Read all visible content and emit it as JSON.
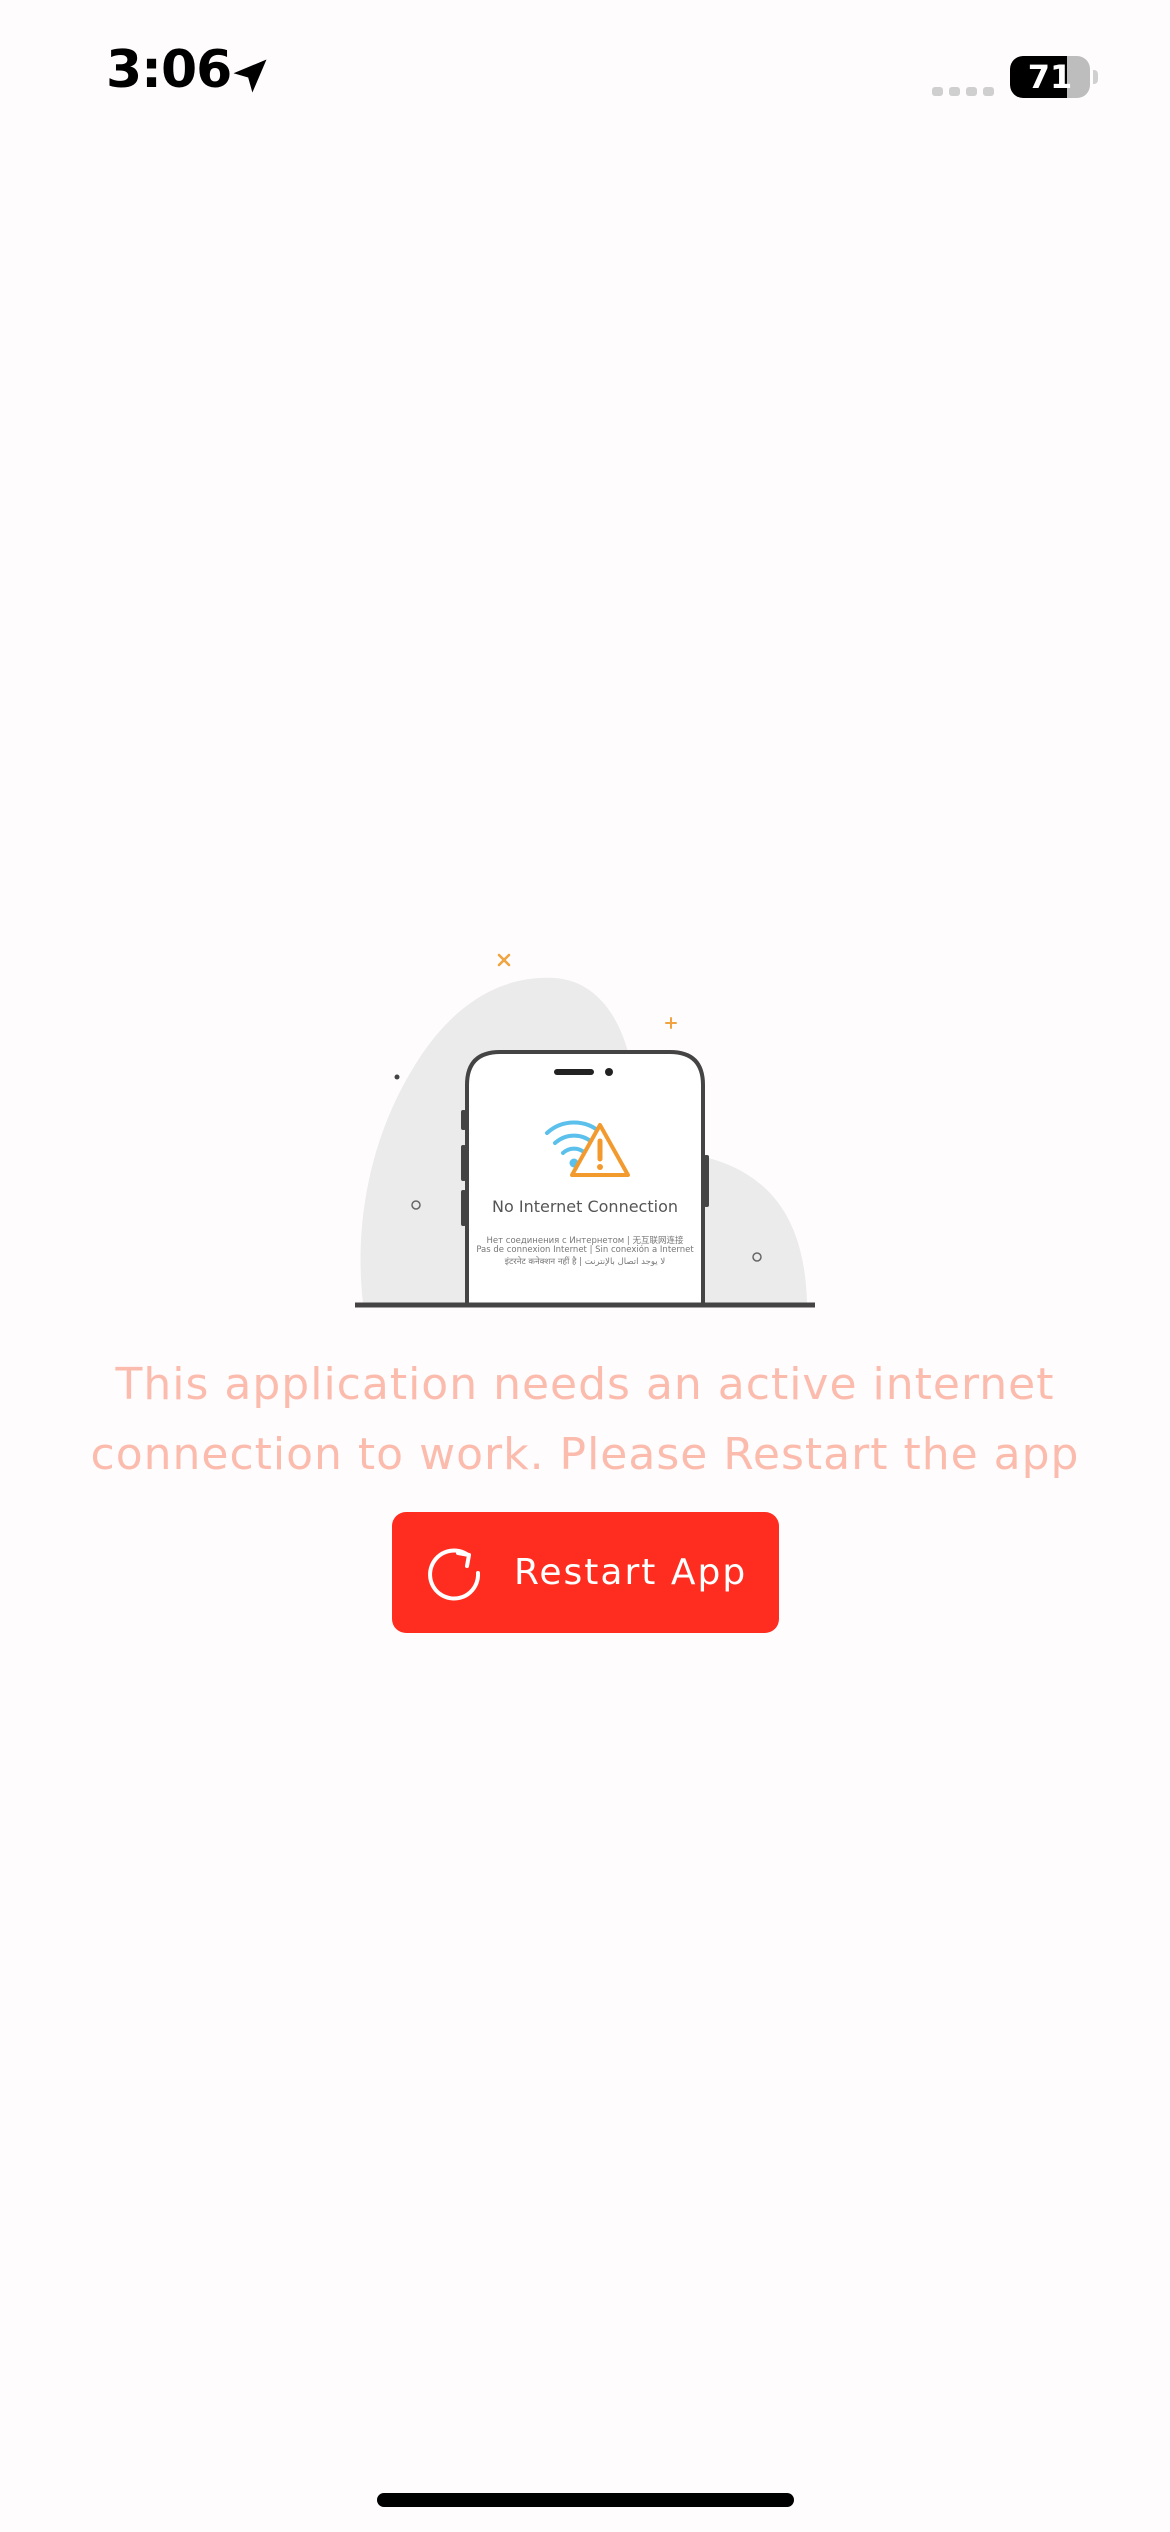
{
  "status_bar": {
    "time": "3:06",
    "battery_level": "71",
    "battery_fraction": 0.71,
    "icons": {
      "location": "location-arrow-icon",
      "signal": "cellular-signal-icon",
      "battery": "battery-icon"
    }
  },
  "illustration": {
    "title": "No Internet Connection",
    "lines": [
      "Нет соединения с Интернетом | 无互联网连接",
      "Pas de connexion Internet | Sin conexión a Internet",
      "इंटरनेट कनेक्शन नहीं है | لا يوجد اتصال بالإنترنت"
    ],
    "icons": {
      "wifi": "wifi-icon",
      "warning": "warning-triangle-icon"
    },
    "colors": {
      "wifi": "#5bc0eb",
      "warning": "#f39a2e",
      "blob": "#ebebeb",
      "phone_outline": "#444444"
    }
  },
  "message": {
    "line1": "This application needs an active internet",
    "line2": "connection to work. Please Restart the app"
  },
  "restart_button": {
    "label": "Restart App",
    "icon": "refresh-icon"
  },
  "colors": {
    "background": "#fffcfd",
    "accent": "#ff2d20",
    "message_text": "#fbbcae"
  }
}
